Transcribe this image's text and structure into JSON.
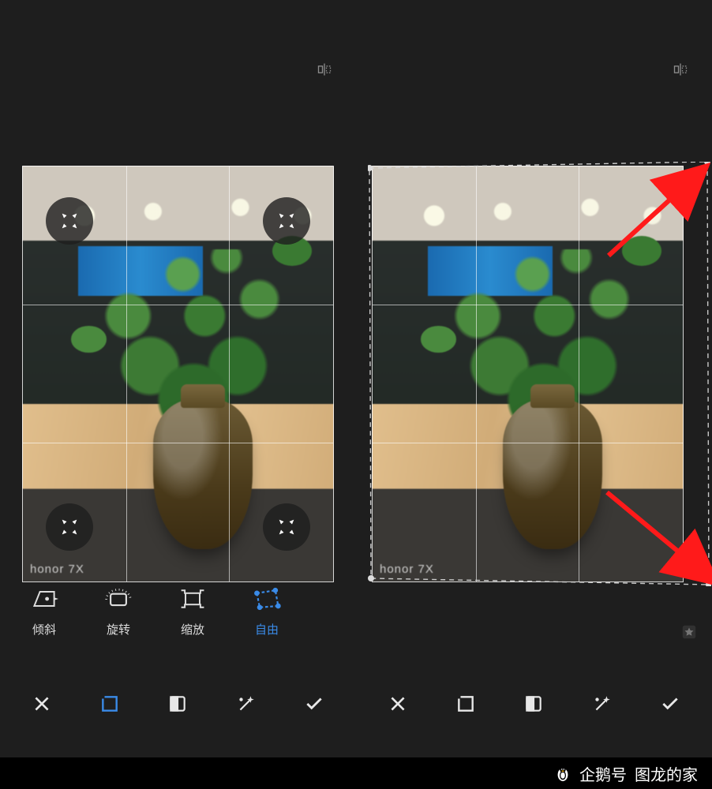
{
  "photo_watermark": "honor 7X",
  "tools": {
    "skew": "倾斜",
    "rotate": "旋转",
    "scale": "缩放",
    "free": "自由"
  },
  "footer": {
    "source": "企鹅号",
    "author": "图龙的家"
  },
  "accent_color": "#3a8be8"
}
